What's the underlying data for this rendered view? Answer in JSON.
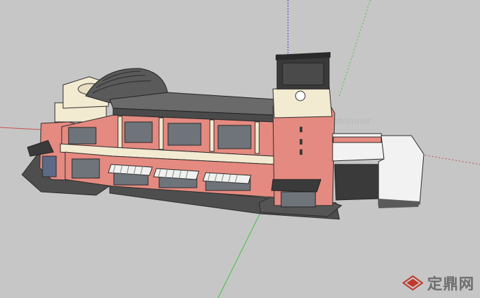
{
  "viewport": {
    "background": "#c6c6c6"
  },
  "colors": {
    "brick": "#e58a80",
    "cream": "#f3ead2",
    "roof": "#5a5a5a",
    "dark": "#3a3a3a",
    "glass": "#6e747a",
    "annex": "#f2f2f2",
    "axis_red": "#c94b4b",
    "axis_green": "#3cc43c",
    "axis_blue": "#3a3ad0"
  },
  "model": {
    "icon": "building-model-icon"
  },
  "watermark": {
    "text": "定鼎网",
    "icon": "diamond-logo-icon",
    "faint": "zhidimer"
  }
}
